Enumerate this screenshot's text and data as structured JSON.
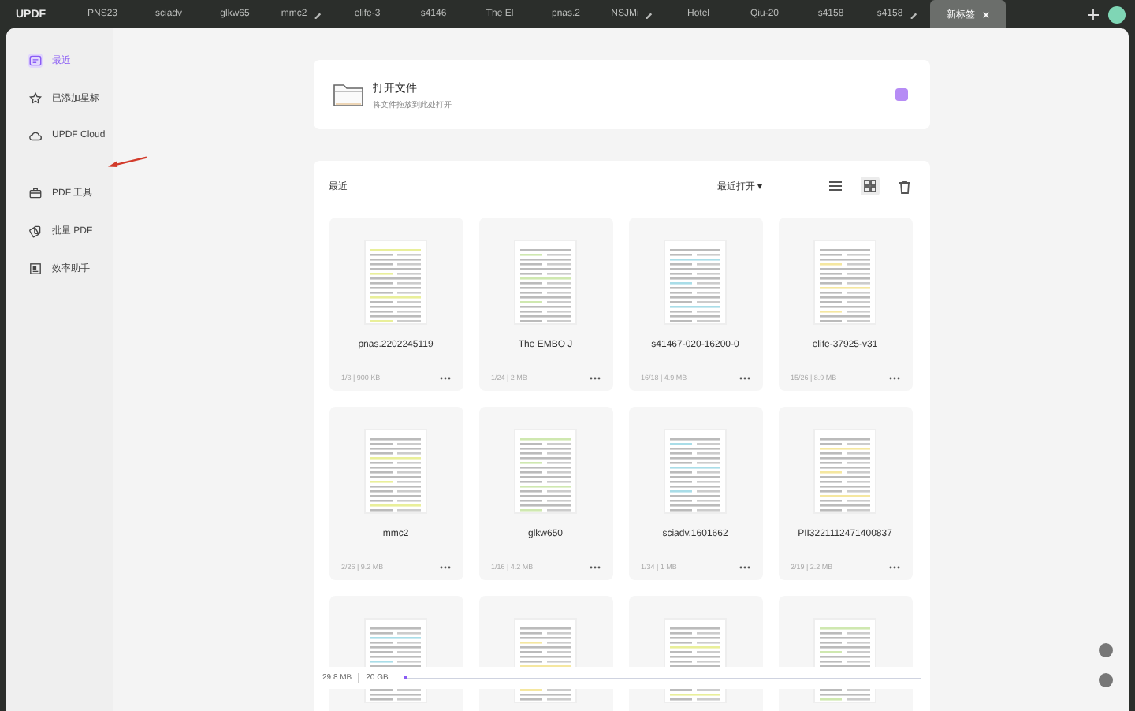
{
  "app": {
    "logo": "UPDF"
  },
  "tabs": [
    {
      "label": "PNS23",
      "selected": false,
      "pinned": false
    },
    {
      "label": "sciadv",
      "selected": false,
      "pinned": false
    },
    {
      "label": "glkw65",
      "selected": false,
      "pinned": false
    },
    {
      "label": "mmc2",
      "selected": false,
      "pinned": true
    },
    {
      "label": "elife-3",
      "selected": false,
      "pinned": false
    },
    {
      "label": "s4146",
      "selected": false,
      "pinned": false
    },
    {
      "label": "The El",
      "selected": false,
      "pinned": false
    },
    {
      "label": "pnas.2",
      "selected": false,
      "pinned": false
    },
    {
      "label": "NSJMi",
      "selected": false,
      "pinned": true
    },
    {
      "label": "Hotel",
      "selected": false,
      "pinned": false
    },
    {
      "label": "Qiu-20",
      "selected": false,
      "pinned": false
    },
    {
      "label": "s4158",
      "selected": false,
      "pinned": false
    },
    {
      "label": "s4158",
      "selected": false,
      "pinned": true
    },
    {
      "label": "新标签",
      "selected": true,
      "pinned": false
    }
  ],
  "sidebar": {
    "items": [
      {
        "label": "最近",
        "selected": true
      },
      {
        "label": "已添加星标",
        "selected": false
      },
      {
        "label": "UPDF Cloud",
        "selected": false
      },
      {
        "label": "PDF 工具",
        "selected": false
      },
      {
        "label": "批量 PDF",
        "selected": false
      },
      {
        "label": "效率助手",
        "selected": false
      }
    ]
  },
  "open_file": {
    "title": "打开文件",
    "subtitle": "将文件拖放到此处打开"
  },
  "recent": {
    "title": "最近",
    "sort": "最近打开 ▾",
    "files": [
      {
        "name": "pnas.2202245119",
        "meta": "1/3 | 900 KB"
      },
      {
        "name": "The EMBO J",
        "meta": "1/24 | 2 MB"
      },
      {
        "name": "s41467-020-16200-0",
        "meta": "16/18 | 4.9 MB"
      },
      {
        "name": "elife-37925-v31",
        "meta": "15/26 | 8.9 MB"
      },
      {
        "name": "mmc2",
        "meta": "2/26 | 9.2 MB"
      },
      {
        "name": "glkw650",
        "meta": "1/16 | 4.2 MB"
      },
      {
        "name": "sciadv.1601662",
        "meta": "1/34 | 1 MB"
      },
      {
        "name": "PII3221112471400837",
        "meta": "2/19 | 2.2 MB"
      }
    ]
  },
  "storage": {
    "used": "29.8 MB",
    "total": "20 GB",
    "level": 0.0015
  }
}
